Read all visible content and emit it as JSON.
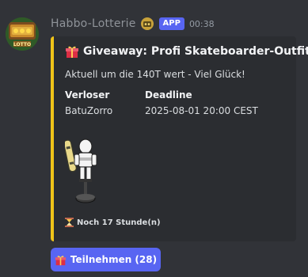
{
  "message": {
    "username": "Habbo-Lotterie",
    "badge": "APP",
    "timestamp": "00:38"
  },
  "embed": {
    "accent_color": "#f0c419",
    "title": "Giveaway: Profi Skateboarder-Outfit",
    "title_icon": "gift-icon",
    "description": "Aktuell um die 140T wert - Viel Glück!",
    "fields": [
      {
        "name": "Verloser",
        "value": "BatuZorro"
      },
      {
        "name": "Deadline",
        "value": "2025-08-01 20:00 CEST"
      }
    ],
    "footer": "Noch 17 Stunde(n)",
    "footer_icon": "hourglass-icon"
  },
  "button": {
    "label": "Teilnehmen (28)",
    "icon": "gift-icon",
    "color": "#5865f2"
  }
}
